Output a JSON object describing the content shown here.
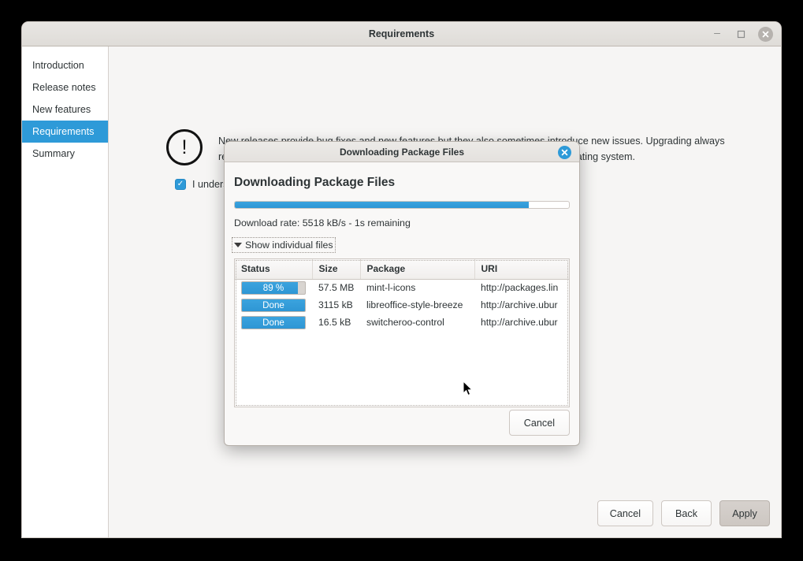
{
  "window": {
    "title": "Requirements",
    "controls": {
      "minimize": "–",
      "maximize": "□",
      "close": "✕"
    }
  },
  "sidebar": {
    "items": [
      {
        "label": "Introduction",
        "selected": false
      },
      {
        "label": "Release notes",
        "selected": false
      },
      {
        "label": "New features",
        "selected": false
      },
      {
        "label": "Requirements",
        "selected": true
      },
      {
        "label": "Summary",
        "selected": false
      }
    ]
  },
  "content": {
    "warning_icon": "exclamation-mark",
    "warning_text": "New releases provide bug fixes and new features but they also sometimes introduce new issues. Upgrading always represents a risk. Your data is safe but new issues can potentially affect your operating system.",
    "agree_checked": true,
    "agree_check_glyph": "✓",
    "agree_label": "I underst"
  },
  "footer": {
    "cancel_label": "Cancel",
    "back_label": "Back",
    "apply_label": "Apply"
  },
  "dialog": {
    "titlebar_title": "Downloading Package Files",
    "close_glyph": "✕",
    "heading": "Downloading Package Files",
    "progress_percent": 88,
    "rate_text": "Download rate: 5518 kB/s - 1s remaining",
    "disclosure_label": "Show individual files",
    "disclosure_expanded": true,
    "columns": [
      "Status",
      "Size",
      "Package",
      "URI"
    ],
    "rows": [
      {
        "status_label": "89 %",
        "status_percent": 89,
        "size": "57.5 MB",
        "package": "mint-l-icons",
        "uri": "http://packages.lin"
      },
      {
        "status_label": "Done",
        "status_percent": 100,
        "size": "3115 kB",
        "package": "libreoffice-style-breeze",
        "uri": "http://archive.ubur"
      },
      {
        "status_label": "Done",
        "status_percent": 100,
        "size": "16.5 kB",
        "package": "switcheroo-control",
        "uri": "http://archive.ubur"
      }
    ],
    "cancel_label": "Cancel"
  },
  "colors": {
    "accent": "#2e9ad8",
    "desktop": "#000000",
    "content_bg": "#f6f5f4"
  }
}
